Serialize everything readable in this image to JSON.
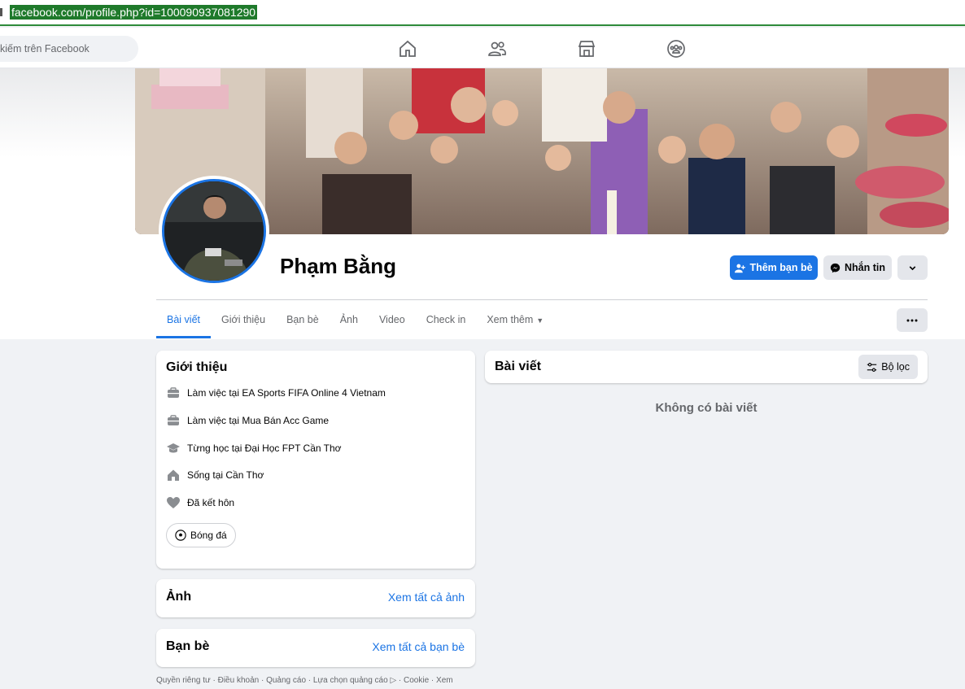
{
  "browser": {
    "url": "facebook.com/profile.php?id=100090937081290"
  },
  "topnav": {
    "search_placeholder": "kiếm trên Facebook",
    "icons": [
      "home-icon",
      "friends-icon",
      "marketplace-icon",
      "groups-icon"
    ]
  },
  "profile": {
    "name": "Phạm Bằng",
    "add_friend_label": "Thêm bạn bè",
    "message_label": "Nhắn tin"
  },
  "tabs": [
    {
      "label": "Bài viết",
      "active": true
    },
    {
      "label": "Giới thiệu"
    },
    {
      "label": "Bạn bè"
    },
    {
      "label": "Ảnh"
    },
    {
      "label": "Video"
    },
    {
      "label": "Check in"
    },
    {
      "label": "Xem thêm"
    }
  ],
  "intro": {
    "title": "Giới thiệu",
    "items": [
      {
        "icon": "briefcase-icon",
        "prefix": "Làm việc tại ",
        "value": "EA Sports FIFA Online 4 Vietnam"
      },
      {
        "icon": "briefcase-icon",
        "prefix": "Làm việc tại ",
        "value": "Mua Bán Acc Game"
      },
      {
        "icon": "graduation-cap-icon",
        "prefix": "Từng học tại ",
        "value": "Đại Học FPT Cần Thơ"
      },
      {
        "icon": "house-icon",
        "prefix": "Sống tại ",
        "value": "Cần Thơ"
      },
      {
        "icon": "heart-icon",
        "prefix": "Đã kết hôn",
        "value": ""
      }
    ],
    "hobby": "Bóng đá"
  },
  "photos": {
    "title": "Ảnh",
    "see_all": "Xem tất cả ảnh"
  },
  "friends": {
    "title": "Bạn bè",
    "see_all": "Xem tất cả bạn bè"
  },
  "footer": "Quyền riêng tư · Điều khoản · Quảng cáo · Lựa chọn quảng cáo ▷ · Cookie · Xem",
  "posts": {
    "title": "Bài viết",
    "filter_label": "Bộ lọc",
    "empty_text": "Không có bài viết"
  },
  "colors": {
    "accent": "#1b74e4",
    "url_highlight": "#1f7a2b"
  }
}
